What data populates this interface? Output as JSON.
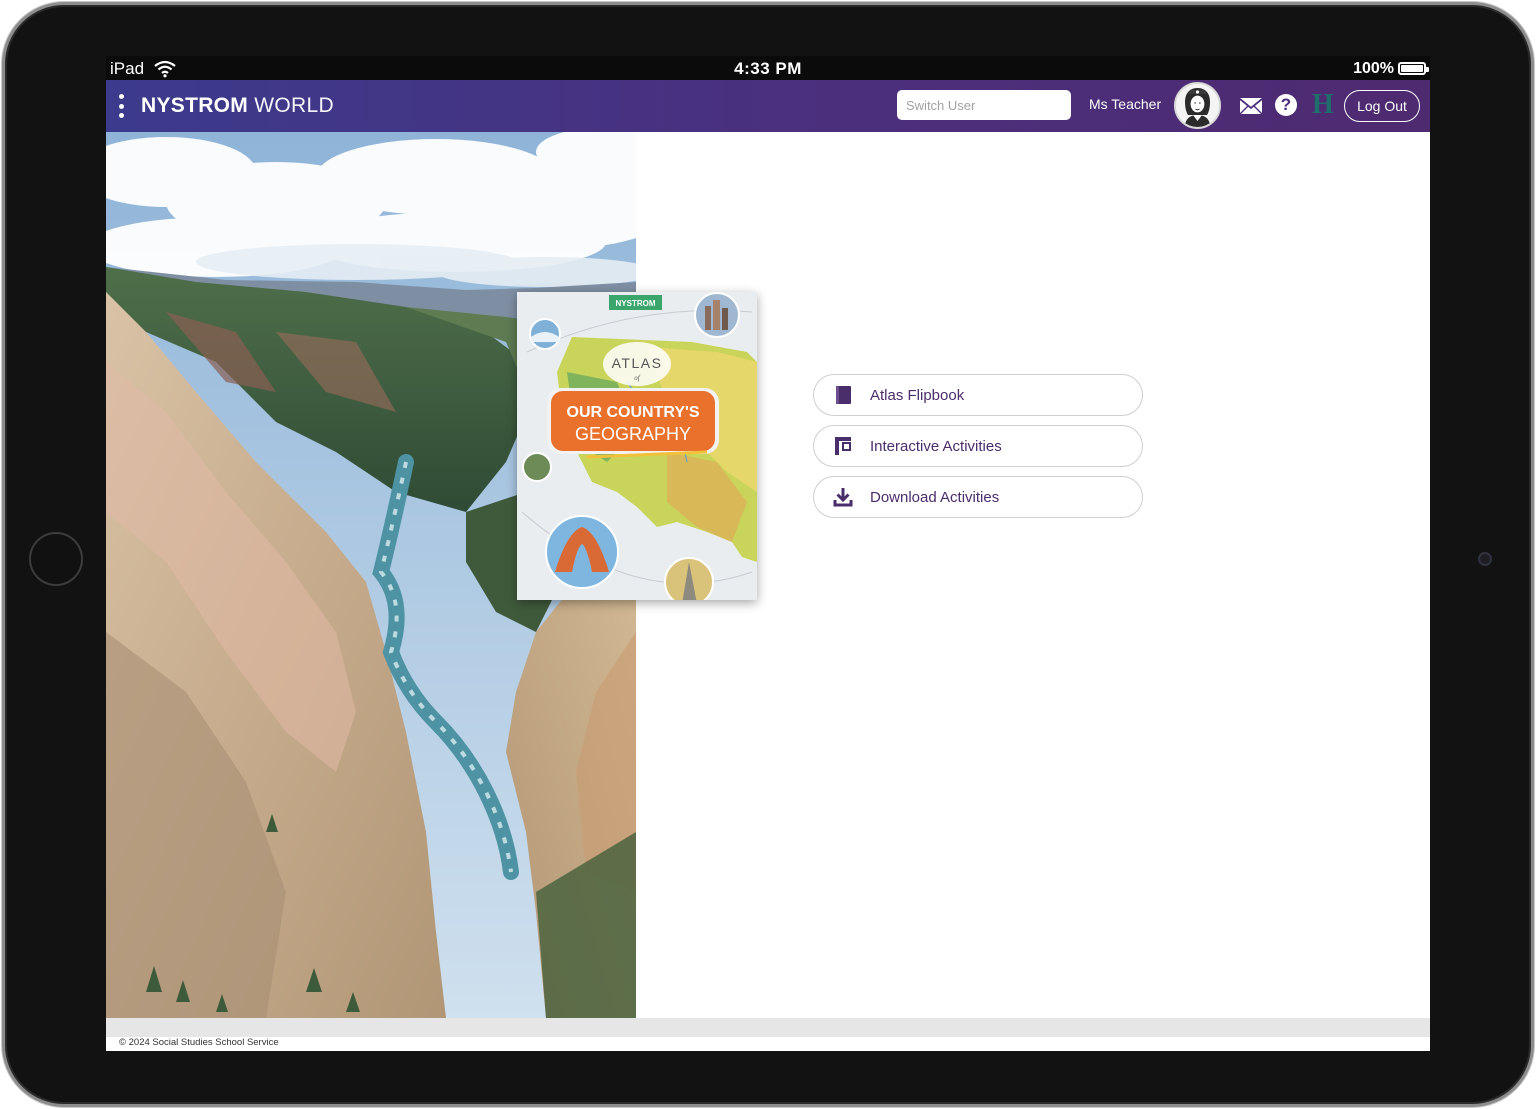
{
  "status_bar": {
    "device": "iPad",
    "time": "4:33 PM",
    "battery": "100%"
  },
  "header": {
    "brand_bold": "NYSTROM",
    "brand_light": "WORLD",
    "switch_user_placeholder": "Switch User",
    "user_name": "Ms Teacher",
    "help_glyph": "?",
    "h_glyph": "H",
    "logout_label": "Log Out",
    "icons": [
      "menu-dots-icon",
      "avatar",
      "mail-icon",
      "help-icon",
      "h-icon"
    ]
  },
  "cover": {
    "publisher": "NYSTROM",
    "title_top": "ATLAS",
    "title_of": "of",
    "title_line1": "OUR COUNTRY'S",
    "title_line2": "GEOGRAPHY"
  },
  "actions": [
    {
      "label": "Atlas Flipbook",
      "icon": "book-icon"
    },
    {
      "label": "Interactive Activities",
      "icon": "activities-icon"
    },
    {
      "label": "Download Activities",
      "icon": "download-icon"
    }
  ],
  "footer": {
    "copyright": "© 2024 Social Studies School Service"
  },
  "colors": {
    "header_start": "#3c3a8c",
    "header_end": "#4e2a70",
    "action_text": "#4a2d6b",
    "cover_orange": "#e9712c"
  }
}
